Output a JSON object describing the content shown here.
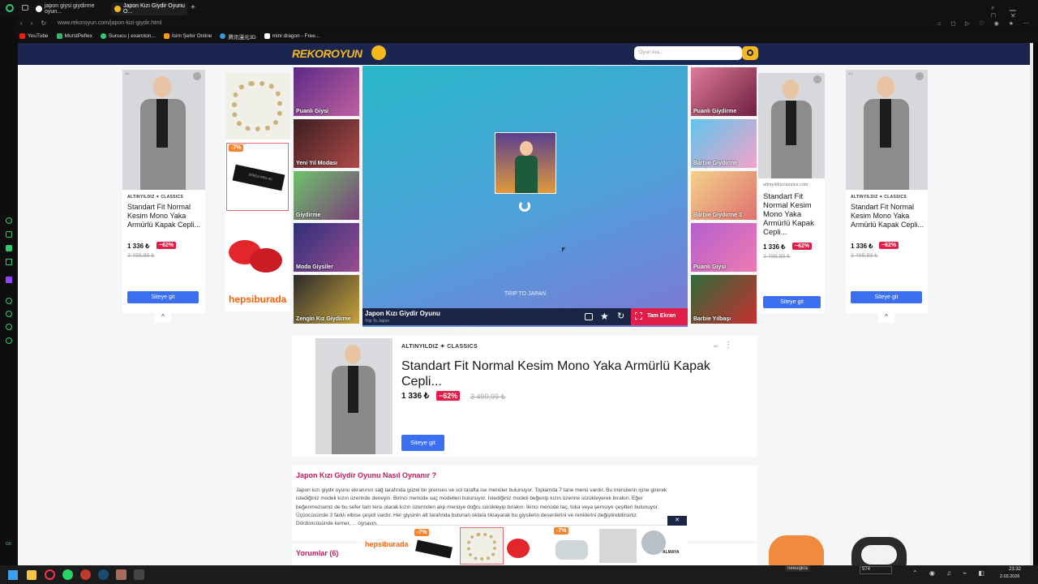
{
  "browser": {
    "tabs": [
      {
        "label": "japon giysi giydirme oyun..."
      },
      {
        "label": "Japon Kızı Giydir Oyunu O..."
      }
    ],
    "url": "www.rekoroyun.com/japon-kizi-giydir.html",
    "bookmarks": [
      "YouTube",
      "MurstPeflex",
      "Sunucu | exaroton...",
      "İsim Şehir Online",
      "腾讯漫元3D",
      "mini dragon - Free..."
    ]
  },
  "site": {
    "logo": "REKOROYUN",
    "search_placeholder": "Oyun Ara..."
  },
  "ad": {
    "brand": "ALTINYILDIZ ✦ CLASSICS",
    "brand_alt": "altinyildizclassics.com",
    "title_short": "Standart Fit Normal Kesim Mono Yaka Armürlü Kapak Cepli...",
    "title_full": "Standart Fit Normal Kesim Mono Yaka Armürlü Kapak Cepli...",
    "price": "1 336 ₺",
    "discount": "−62%",
    "old_price": "3 499,99 ₺",
    "cta": "Siteye git",
    "ad_mark": "AD",
    "hb_discount": "-7%",
    "hb_brand": "hepsiburada",
    "ssd_label": "SPEED PRO 4G",
    "almaya": "ALMAYA"
  },
  "left_games": [
    {
      "label": "Puanlı Giysi",
      "color": "#6f2c8f"
    },
    {
      "label": "Yeni Yıl Modası",
      "color": "#7a2b3a"
    },
    {
      "label": "Giydirme",
      "color": "#4aa04a"
    },
    {
      "label": "Moda Giysiler",
      "color": "#3a3f8a"
    },
    {
      "label": "Zengin Kız Giydirme",
      "color": "#2b2b2b"
    }
  ],
  "right_games": [
    {
      "label": "Puanlı Giydirme",
      "color": "#9c3b5c"
    },
    {
      "label": "Barbie Giydirme",
      "color": "#2b8fc4"
    },
    {
      "label": "Barbie Giydirme 3",
      "color": "#c48f3b"
    },
    {
      "label": "Puanlı Giysi",
      "color": "#8f3b8f"
    },
    {
      "label": "Barbie Yılbaşı",
      "color": "#2f6b3a"
    }
  ],
  "game": {
    "title": "Japon Kızı Giydir Oyunu",
    "subtitle": "Trip To Japon",
    "splash": "TRIP TO JAPAN",
    "fullscreen": "Tam Ekran"
  },
  "faq": {
    "heading": "Japon Kızı Giydir Oyunu Nasıl Oynanır ?",
    "lines": [
      "Japon kızı giydir oyunu ekranının sağ tarafında güzel bir prenses ve sol tarafta ise menüler bulunuyor. Toplamda 7 tane menü vardır. Bu menülerin içine girerek",
      "istediğiniz modeli kızın üzerinde deneyin. Birinci menüde saç modelleri bulunuyor. İstediğiniz modeli beğenip kızın üzerine sürükleyerek bırakın. Eğer",
      "beğenmezseniz de bu sefer tam tersi olarak kızın üzerinden alıp menüye doğru sürükleyip bırakın. İkinci menüde taç, toka veya şemsiye çeşitleri bulunuyor.",
      "Üçüncüsünde 3 farklı elbise çeşidi vardır. Her giysinin alt tarafında bulunan oklara tıklayarak bu giysilerin desenlerini ve renklerini değiştirebilirsiniz.",
      "Dördüncüsünde kemer, ... oynayın."
    ],
    "comments": "Yorumlar (6)"
  },
  "taskbar": {
    "user": "neeuqkra",
    "field": "974",
    "time": "23:32",
    "date": "2.03.2026"
  },
  "side": {
    "gk": "GK"
  }
}
